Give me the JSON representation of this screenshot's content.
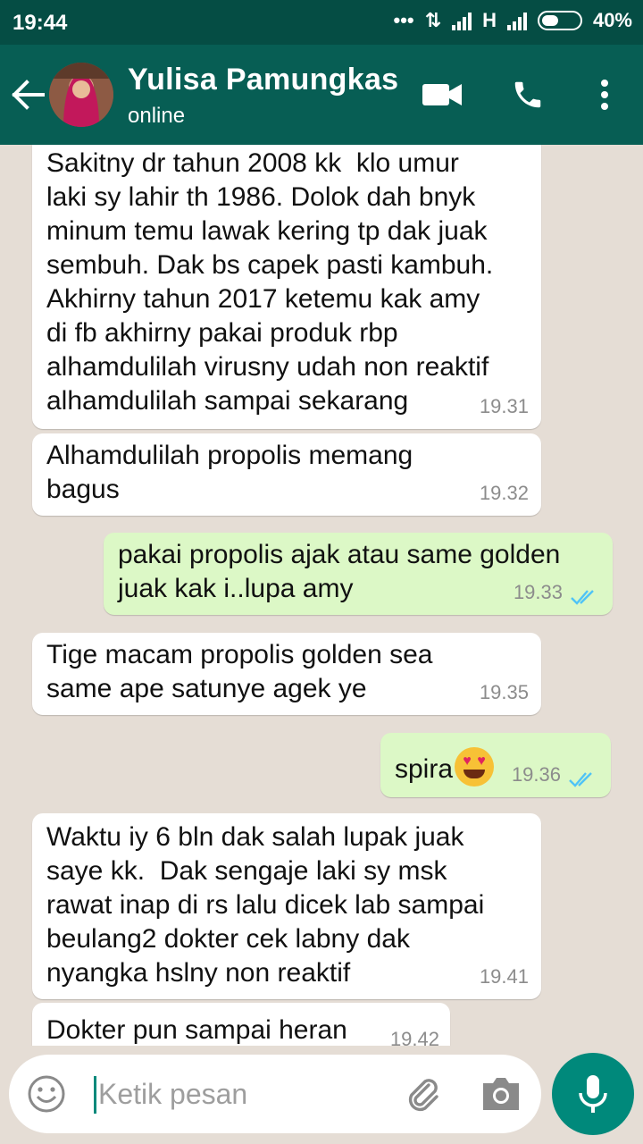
{
  "status_bar": {
    "time": "19:44",
    "network": "H",
    "battery": "40%"
  },
  "header": {
    "contact_name": "Yulisa Pamungkas",
    "contact_status": "online",
    "icons": [
      "back-arrow-icon",
      "video-call-icon",
      "phone-icon",
      "more-vert-icon"
    ]
  },
  "messages": [
    {
      "direction": "in",
      "lines": [
        "Sakitny dr tahun 2008 kk  klo umur",
        "laki sy lahir th 1986. Dolok dah bnyk",
        "minum temu lawak kering tp dak juak",
        "sembuh. Dak bs capek pasti kambuh.",
        "Akhirny tahun 2017 ketemu kak amy",
        "di fb akhirny pakai produk rbp",
        "alhamdulilah virusny udah non reaktif",
        "alhamdulilah sampai sekarang"
      ],
      "time": "19.31"
    },
    {
      "direction": "in",
      "lines": [
        "Alhamdulilah propolis memang",
        "bagus"
      ],
      "time": "19.32"
    },
    {
      "direction": "out",
      "lines": [
        "pakai propolis ajak atau same golden",
        "juak kak i..lupa amy"
      ],
      "time": "19.33",
      "status": "read"
    },
    {
      "direction": "in",
      "lines": [
        "Tige macam propolis golden sea",
        "same ape satunye agek ye"
      ],
      "time": "19.35"
    },
    {
      "direction": "out",
      "text": "spira",
      "emoji": "heart-eyes-emoji",
      "time": "19.36",
      "status": "read"
    },
    {
      "direction": "in",
      "lines": [
        "Waktu iy 6 bln dak salah lupak juak",
        "saye kk.  Dak sengaje laki sy msk",
        "rawat inap di rs lalu dicek lab sampai",
        "beulang2 dokter cek labny dak",
        "nyangka hslny non reaktif"
      ],
      "time": "19.41"
    },
    {
      "direction": "in",
      "lines": [
        "Dokter pun sampai heran"
      ],
      "time": "19.42"
    }
  ],
  "composer": {
    "placeholder": "Ketik pesan",
    "icons": [
      "emoji-icon",
      "attach-icon",
      "camera-icon",
      "mic-icon"
    ]
  },
  "colors": {
    "header": "#075e54",
    "status_bar": "#054d44",
    "incoming_bubble": "#ffffff",
    "outgoing_bubble": "#dcf8c6",
    "read_ticks": "#4fc3f7",
    "accent": "#00897b",
    "chat_background": "#e5ddd5"
  }
}
